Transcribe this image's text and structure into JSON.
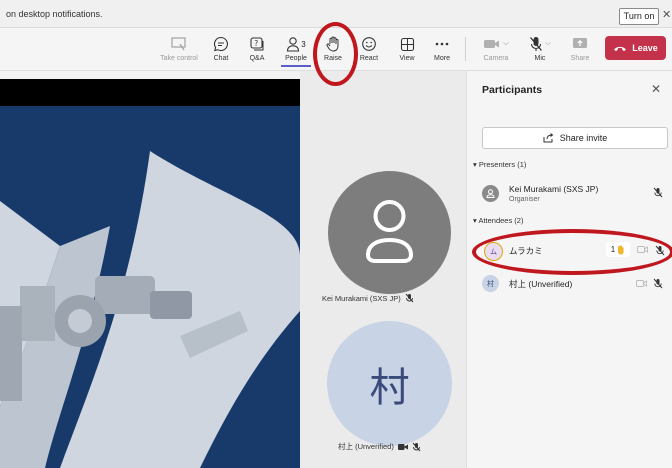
{
  "notification": {
    "text": "on desktop notifications.",
    "turn_on": "Turn on"
  },
  "toolbar": {
    "take_control": "Take control",
    "chat": "Chat",
    "qa": "Q&A",
    "people": "People",
    "people_count": "3",
    "raise": "Raise",
    "react": "React",
    "view": "View",
    "more": "More",
    "camera": "Camera",
    "mic": "Mic",
    "share": "Share",
    "leave": "Leave"
  },
  "tiles": {
    "user1_name": "Kei Murakami (SXS JP)",
    "user2_initial": "村",
    "user2_name": "村上 (Unverified)"
  },
  "participants": {
    "title": "Participants",
    "share_invite": "Share invite",
    "presenters_label": "Presenters (1)",
    "attendees_label": "Attendees (2)",
    "presenter": {
      "name": "Kei Murakami (SXS JP)",
      "role": "Organiser"
    },
    "attendee1": {
      "initial": "ム",
      "name": "ムラカミ",
      "hand_count": "1"
    },
    "attendee2": {
      "initial": "村",
      "name": "村上 (Unverified)"
    }
  },
  "colors": {
    "accent": "#5b5fc7",
    "leave": "#c4314b",
    "annotation": "#c0171f",
    "stage_blue": "#173a6b"
  }
}
